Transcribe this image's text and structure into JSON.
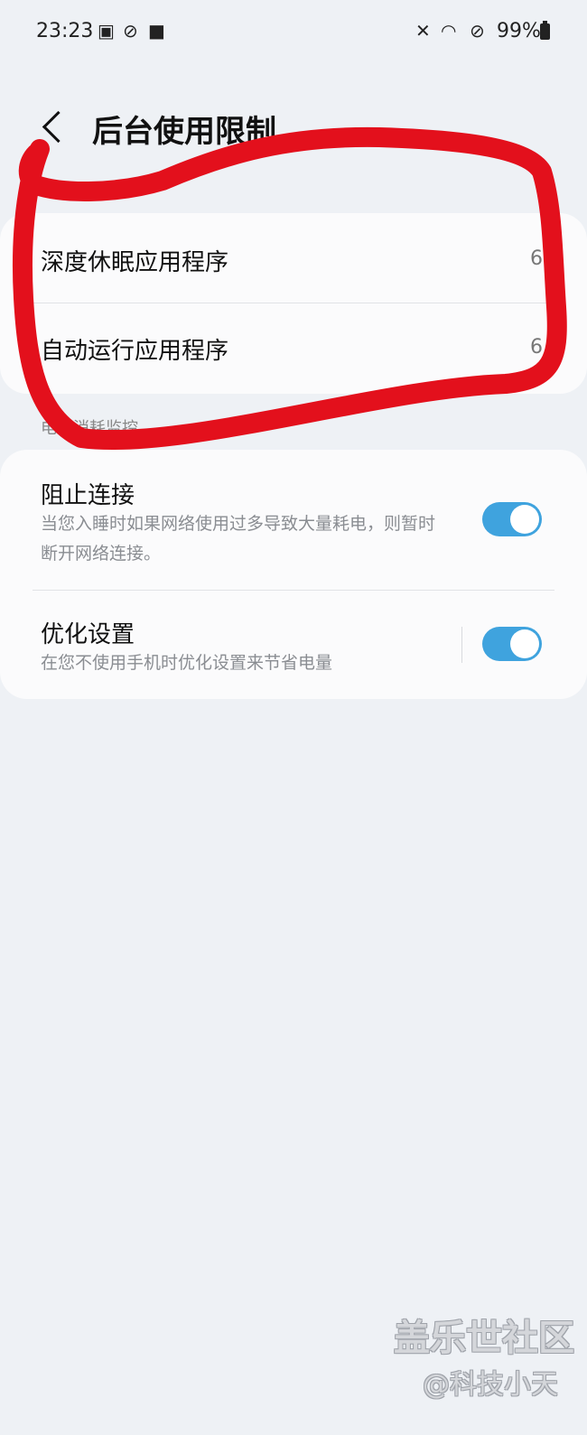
{
  "status_bar": {
    "time": "23:23",
    "icons": [
      "image-icon",
      "blocked-icon",
      "bag-icon",
      "mute-icon",
      "wifi-icon",
      "no-disturb-icon",
      "battery-icon"
    ],
    "battery": "99%"
  },
  "header": {
    "title": "后台使用限制"
  },
  "apps_card": {
    "items": [
      {
        "label": "深度休眠应用程序",
        "value": "6"
      },
      {
        "label": "自动运行应用程序",
        "value": "6"
      }
    ]
  },
  "section": {
    "label": "电池消耗监控"
  },
  "settings": [
    {
      "title": "阻止连接",
      "desc": "当您入睡时如果网络使用过多导致大量耗电，则暂时断开网络连接。",
      "enabled": true
    },
    {
      "title": "优化设置",
      "desc": "在您不使用手机时优化设置来节省电量",
      "enabled": true
    }
  ],
  "colors": {
    "accent": "#3fa3de",
    "annotation": "#e3101c",
    "background": "#eef1f5"
  },
  "watermark": {
    "title": "盖乐世社区",
    "author": "@科技小天"
  }
}
